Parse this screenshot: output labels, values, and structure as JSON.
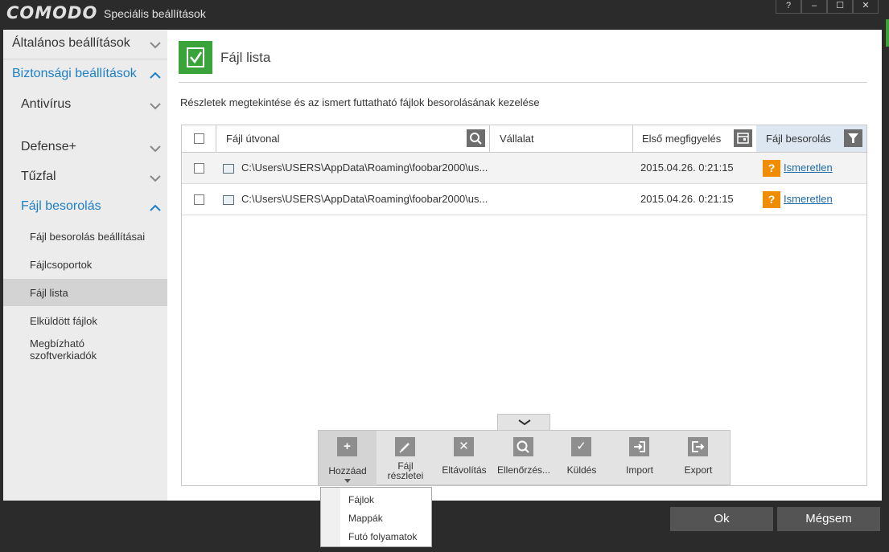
{
  "window": {
    "logo": "COMODO",
    "title": "Speciális beállítások",
    "controls": {
      "help": "?",
      "minimize": "–",
      "maximize": "☐",
      "close": "✕"
    }
  },
  "sidebar": {
    "general": "Általános beállítások",
    "security": "Biztonsági beállítások",
    "antivirus": "Antivírus",
    "defense": "Defense+",
    "firewall": "Tűzfal",
    "file_rating": "Fájl besorolás",
    "sub": {
      "settings": "Fájl besorolás beállításai",
      "groups": "Fájlcsoportok",
      "file_list": "Fájl lista",
      "submitted": "Elküldött fájlok",
      "vendors_1": "Megbízható",
      "vendors_2": "szoftverkiadók"
    }
  },
  "main": {
    "title": "Fájl lista",
    "description": "Részletek megtekintése és az ismert futtatható fájlok besorolásának kezelése"
  },
  "table": {
    "columns": {
      "path": "Fájl útvonal",
      "company": "Vállalat",
      "first_seen": "Első megfigyelés",
      "rating": "Fájl besorolás"
    },
    "rows": [
      {
        "path": "C:\\Users\\USERS\\AppData\\Roaming\\foobar2000\\us...",
        "company": "",
        "first_seen": "2015.04.26. 0:21:15",
        "badge": "?",
        "rating": "Ismeretlen"
      },
      {
        "path": "C:\\Users\\USERS\\AppData\\Roaming\\foobar2000\\us...",
        "company": "",
        "first_seen": "2015.04.26. 0:21:15",
        "badge": "?",
        "rating": "Ismeretlen"
      }
    ]
  },
  "toolbar": {
    "add": "Hozzáad",
    "details_1": "Fájl",
    "details_2": "részletei",
    "remove": "Eltávolítás",
    "check": "Ellenőrzés...",
    "submit": "Küldés",
    "import": "Import",
    "export": "Export"
  },
  "add_menu": {
    "files": "Fájlok",
    "folders": "Mappák",
    "processes": "Futó folyamatok"
  },
  "buttons": {
    "ok": "Ok",
    "cancel": "Mégsem"
  },
  "colors": {
    "accent_blue": "#1d7fc4",
    "header_green": "#3aa43a",
    "warning_orange": "#f08c00",
    "title_bar": "#2b2b2b"
  },
  "icons": {
    "header": "file-check-icon",
    "search": "search-icon",
    "calendar": "calendar-icon",
    "filter": "filter-icon",
    "chevron_up": "chevron-up-icon",
    "chevron_down": "chevron-down-icon"
  }
}
